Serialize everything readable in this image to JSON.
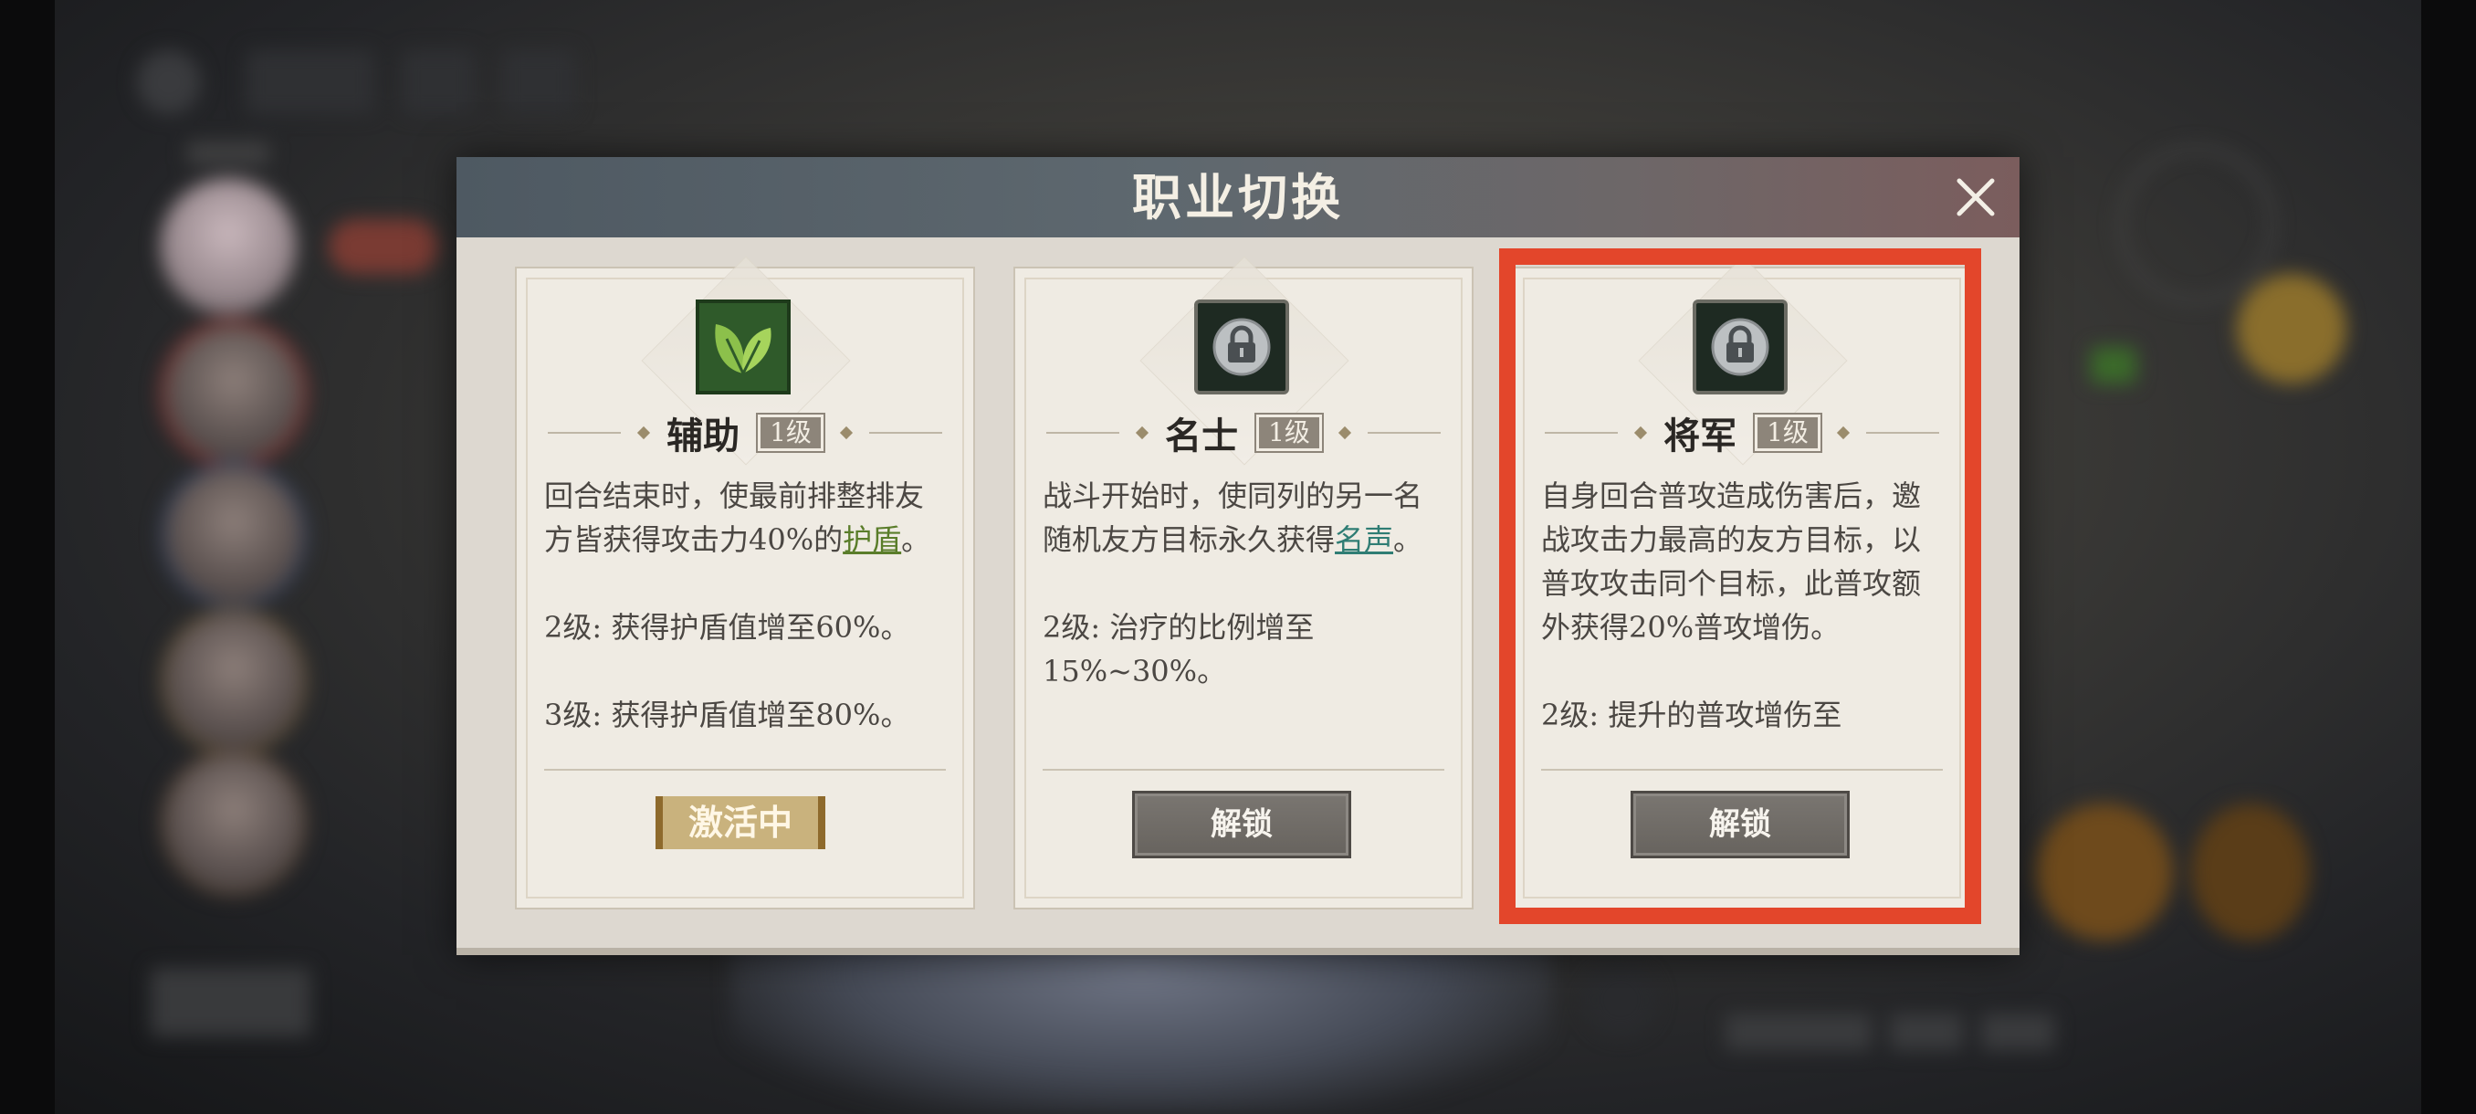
{
  "dialog": {
    "title": "职业切换",
    "close_icon": "close-icon"
  },
  "colors": {
    "highlight": "#e3462b",
    "keyword_green": "#5a7d2a",
    "keyword_teal": "#2f7d74"
  },
  "cards": [
    {
      "name": "辅助",
      "level": "1级",
      "icon": "leaf-icon",
      "desc_prefix": "回合结束时，使最前排整排友方皆获得攻击力40%的",
      "keyword": "护盾",
      "desc_suffix": "。",
      "levels": [
        "2级: 获得护盾值增至60%。",
        "3级: 获得护盾值增至80%。"
      ],
      "status": "激活中"
    },
    {
      "name": "名士",
      "level": "1级",
      "icon": "lock-icon",
      "desc_prefix": "战斗开始时，使同列的另一名随机友方目标永久获得",
      "keyword": "名声",
      "desc_suffix": "。",
      "levels": [
        "2级: 治疗的比例增至15%~30%。"
      ],
      "button": "解锁"
    },
    {
      "name": "将军",
      "level": "1级",
      "icon": "lock-icon",
      "desc": "自身回合普攻造成伤害后，邀战攻击力最高的友方目标，以普攻攻击同个目标，此普攻额外获得20%普攻增伤。",
      "levels": [
        "2级: 提升的普攻增伤至"
      ],
      "button": "解锁"
    }
  ]
}
